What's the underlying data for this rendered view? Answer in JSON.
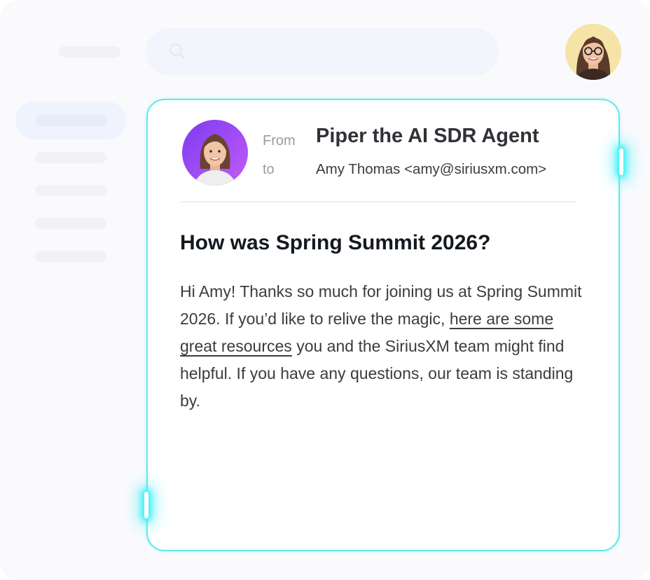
{
  "email": {
    "from_label": "From",
    "to_label": "to",
    "from_name": "Piper the AI SDR Agent",
    "to_address": "Amy Thomas <amy@siriusxm.com>",
    "subject": "How was Spring Summit 2026?",
    "body_before_link": "Hi Amy! Thanks so much for joining us at Spring Summit 2026. If you’d like to relive the magic, ",
    "body_link": "here are some great resources",
    "body_after_link": " you and the SiriusXM team might find helpful. If you have any questions, our team is standing by."
  },
  "icons": {
    "search": "search-icon",
    "user_avatar": "user-avatar",
    "sender_avatar": "sender-avatar"
  },
  "colors": {
    "card_border": "#5ee9ee",
    "glow": "#41f0f6",
    "sender_avatar_bg": "#9b4df7",
    "user_avatar_bg": "#f6e3a8"
  }
}
